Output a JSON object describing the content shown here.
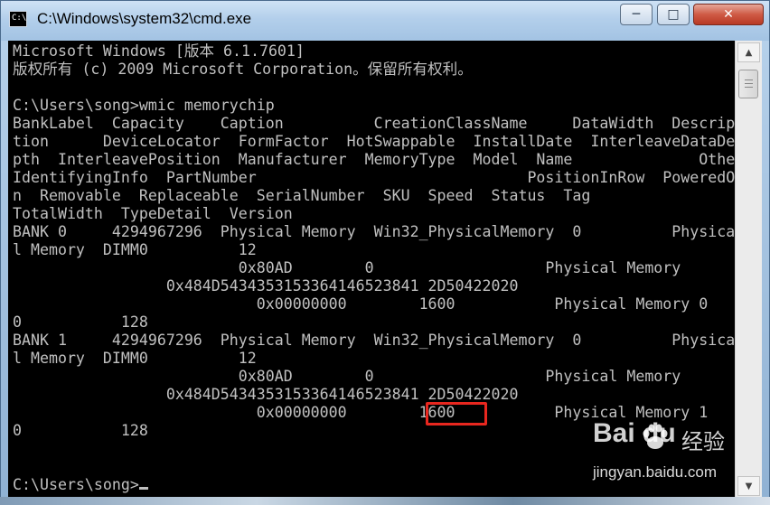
{
  "window": {
    "title": "C:\\Windows\\system32\\cmd.exe",
    "minimize_label": "─",
    "maximize_label": "□",
    "close_label": "✕"
  },
  "console": {
    "lines": [
      "Microsoft Windows [版本 6.1.7601]",
      "版权所有 (c) 2009 Microsoft Corporation。保留所有权利。",
      "",
      "C:\\Users\\song>wmic memorychip",
      "BankLabel  Capacity    Caption          CreationClassName     DataWidth  Descrip",
      "tion      DeviceLocator  FormFactor  HotSwappable  InstallDate  InterleaveDataDe",
      "pth  InterleavePosition  Manufacturer  MemoryType  Model  Name              Other",
      "IdentifyingInfo  PartNumber                              PositionInRow  PoweredO",
      "n  Removable  Replaceable  SerialNumber  SKU  Speed  Status  Tag",
      "TotalWidth  TypeDetail  Version",
      "BANK 0     4294967296  Physical Memory  Win32_PhysicalMemory  0          Physica",
      "l Memory  DIMM0          12",
      "                         0x80AD        0                   Physical Memory",
      "                 0x484D5434353153364146523841 2D50422020",
      "                           0x00000000        1600           Physical Memory 0",
      "0           128",
      "BANK 1     4294967296  Physical Memory  Win32_PhysicalMemory  0          Physica",
      "l Memory  DIMM0          12",
      "                         0x80AD        0                   Physical Memory",
      "                 0x484D5434353153364146523841 2D50422020",
      "                           0x00000000        1600           Physical Memory 1",
      "0           128",
      "",
      "",
      "C:\\Users\\song>"
    ]
  },
  "scrollbar": {
    "up_icon": "▲",
    "down_icon": "▼"
  },
  "watermark": {
    "brand": "Bai du",
    "cn": "经验",
    "url": "jingyan.baidu.com"
  },
  "highlight_color": "#e8271f"
}
